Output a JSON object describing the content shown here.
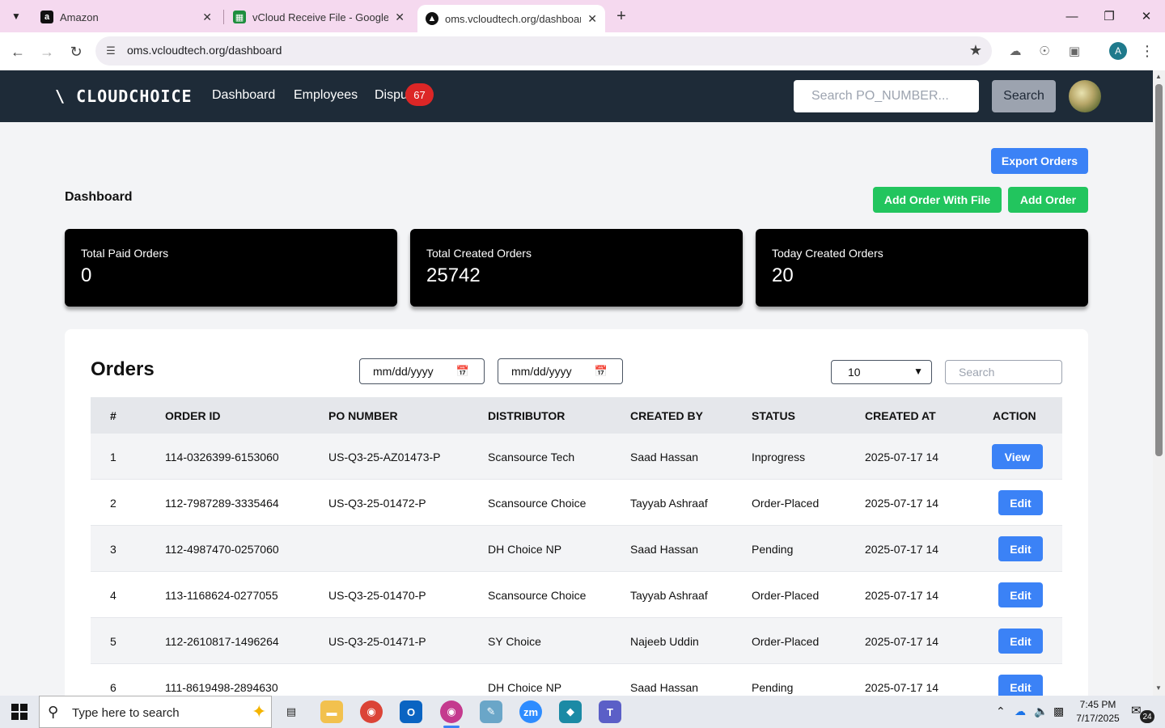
{
  "browser": {
    "tabs": [
      {
        "title": "Amazon",
        "favicon": "amazon-favicon"
      },
      {
        "title": "vCloud Receive File - Google Sh",
        "favicon": "sheets-favicon"
      },
      {
        "title": "oms.vcloudtech.org/dashboard",
        "favicon": "site-favicon"
      }
    ],
    "url": "oms.vcloudtech.org/dashboard",
    "profile_initial": "A"
  },
  "app": {
    "logo": "\\ CLOUDCHOICE",
    "nav": {
      "dashboard": "Dashboard",
      "employees": "Employees",
      "disputes": "Dispu",
      "disputes_badge": "67"
    },
    "po_search_placeholder": "Search PO_NUMBER...",
    "search_label": "Search"
  },
  "page": {
    "heading": "Dashboard",
    "export_label": "Export Orders",
    "add_with_file_label": "Add Order With File",
    "add_order_label": "Add Order"
  },
  "stats": [
    {
      "label": "Total Paid Orders",
      "value": "0"
    },
    {
      "label": "Total Created Orders",
      "value": "25742"
    },
    {
      "label": "Today Created Orders",
      "value": "20"
    }
  ],
  "orders": {
    "title": "Orders",
    "date_from_placeholder": "mm/dd/yyyy",
    "date_to_placeholder": "mm/dd/yyyy",
    "page_size": "10",
    "search_placeholder": "Search",
    "columns": [
      "#",
      "ORDER ID",
      "PO NUMBER",
      "DISTRIBUTOR",
      "CREATED BY",
      "STATUS",
      "CREATED AT",
      "ACTION"
    ],
    "rows": [
      {
        "n": "1",
        "order_id": "114-0326399-6153060",
        "po": "US-Q3-25-AZ01473-P",
        "distributor": "Scansource Tech",
        "created_by": "Saad Hassan",
        "status": "Inprogress",
        "created_at": "2025-07-17 14",
        "action": "View"
      },
      {
        "n": "2",
        "order_id": "112-7987289-3335464",
        "po": "US-Q3-25-01472-P",
        "distributor": "Scansource Choice",
        "created_by": "Tayyab Ashraaf",
        "status": "Order-Placed",
        "created_at": "2025-07-17 14",
        "action": "Edit"
      },
      {
        "n": "3",
        "order_id": "112-4987470-0257060",
        "po": "",
        "distributor": "DH Choice NP",
        "created_by": "Saad Hassan",
        "status": "Pending",
        "created_at": "2025-07-17 14",
        "action": "Edit"
      },
      {
        "n": "4",
        "order_id": "113-1168624-0277055",
        "po": "US-Q3-25-01470-P",
        "distributor": "Scansource Choice",
        "created_by": "Tayyab Ashraaf",
        "status": "Order-Placed",
        "created_at": "2025-07-17 14",
        "action": "Edit"
      },
      {
        "n": "5",
        "order_id": "112-2610817-1496264",
        "po": "US-Q3-25-01471-P",
        "distributor": "SY Choice",
        "created_by": "Najeeb Uddin",
        "status": "Order-Placed",
        "created_at": "2025-07-17 14",
        "action": "Edit"
      },
      {
        "n": "6",
        "order_id": "111-8619498-2894630",
        "po": "",
        "distributor": "DH Choice NP",
        "created_by": "Saad Hassan",
        "status": "Pending",
        "created_at": "2025-07-17 14",
        "action": "Edit"
      }
    ]
  },
  "taskbar": {
    "search_text": "Type here to search",
    "time": "7:45 PM",
    "date": "7/17/2025",
    "notifications": "24"
  },
  "colors": {
    "navbar": "#1e2b38",
    "primary_blue": "#3b82f6",
    "green": "#22c55e",
    "badge_red": "#dc2626"
  }
}
